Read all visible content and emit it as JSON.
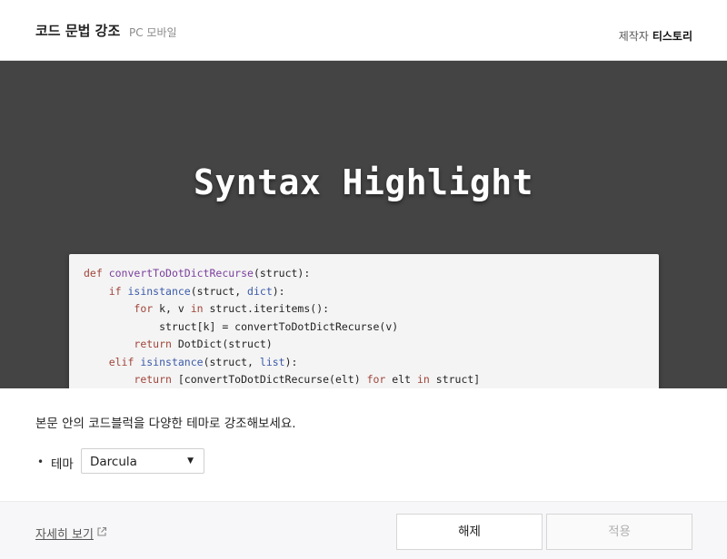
{
  "header": {
    "title": "코드 문법 강조",
    "platforms": "PC 모바일",
    "maker_label": "제작자",
    "maker_name": "티스토리"
  },
  "hero": {
    "title": "Syntax Highlight",
    "code_lines": [
      [
        {
          "t": "def ",
          "c": "kw"
        },
        {
          "t": "convertToDotDictRecurse",
          "c": "fn"
        },
        {
          "t": "(struct):",
          "c": ""
        }
      ],
      [
        {
          "t": "    ",
          "c": ""
        },
        {
          "t": "if ",
          "c": "kw"
        },
        {
          "t": "isinstance",
          "c": "bi"
        },
        {
          "t": "(struct, ",
          "c": ""
        },
        {
          "t": "dict",
          "c": "bi"
        },
        {
          "t": "):",
          "c": ""
        }
      ],
      [
        {
          "t": "        ",
          "c": ""
        },
        {
          "t": "for ",
          "c": "kw"
        },
        {
          "t": "k, v ",
          "c": ""
        },
        {
          "t": "in ",
          "c": "kw"
        },
        {
          "t": "struct.iteritems():",
          "c": ""
        }
      ],
      [
        {
          "t": "            struct[k] = convertToDotDictRecurse(v)",
          "c": ""
        }
      ],
      [
        {
          "t": "        ",
          "c": ""
        },
        {
          "t": "return ",
          "c": "kw"
        },
        {
          "t": "DotDict(struct)",
          "c": ""
        }
      ],
      [
        {
          "t": "    ",
          "c": ""
        },
        {
          "t": "elif ",
          "c": "kw"
        },
        {
          "t": "isinstance",
          "c": "bi"
        },
        {
          "t": "(struct, ",
          "c": ""
        },
        {
          "t": "list",
          "c": "bi"
        },
        {
          "t": "):",
          "c": ""
        }
      ],
      [
        {
          "t": "        ",
          "c": ""
        },
        {
          "t": "return ",
          "c": "kw"
        },
        {
          "t": "[convertToDotDictRecurse(elt) ",
          "c": ""
        },
        {
          "t": "for ",
          "c": "kw"
        },
        {
          "t": "elt ",
          "c": ""
        },
        {
          "t": "in ",
          "c": "kw"
        },
        {
          "t": "struct]",
          "c": ""
        }
      ]
    ]
  },
  "body": {
    "description": "본문 안의 코드블럭을 다양한 테마로 강조해보세요.",
    "bullet": "•",
    "theme_label": "테마",
    "theme_value": "Darcula",
    "caret_icon": "caret-down-icon"
  },
  "footer": {
    "more_link": "자세히 보기",
    "ext_icon": "external-link-icon",
    "release_button": "해제",
    "apply_button": "적용"
  },
  "colors": {
    "hero_bg": "#444444",
    "keyword": "#a0453a",
    "function": "#7a3e9d",
    "builtin": "#3b5aa8"
  }
}
